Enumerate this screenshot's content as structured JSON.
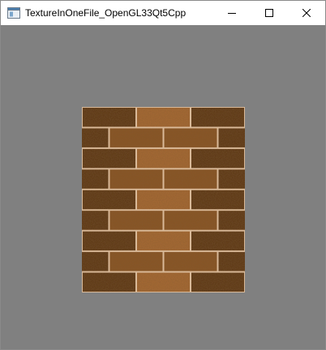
{
  "window": {
    "title": "TextureInOneFile_OpenGL33Qt5Cpp",
    "icon": "application-window-icon",
    "controls": [
      {
        "name": "minimize-button",
        "icon": "minimize-icon"
      },
      {
        "name": "maximize-button",
        "icon": "maximize-icon"
      },
      {
        "name": "close-button",
        "icon": "close-icon"
      }
    ]
  },
  "viewport": {
    "clear_color": "#808080",
    "content": "brick-texture-quad"
  },
  "colors": {
    "brick_dark": "#5a3418",
    "brick_mid": "#8a5428",
    "brick_light": "#a86a36",
    "mortar": "#d9b998"
  }
}
